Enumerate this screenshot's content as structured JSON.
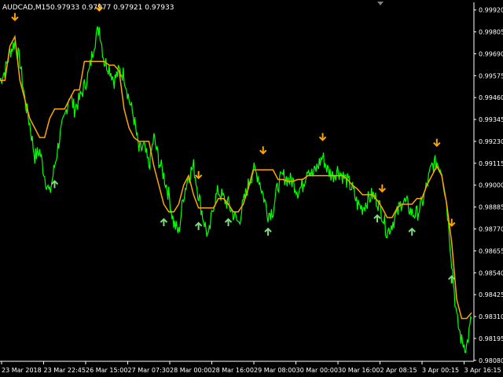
{
  "header": {
    "symbol_tf": "AUDCAD,M15",
    "ohlc": "0.97933 0.97977 0.97921 0.97933"
  },
  "colors": {
    "background": "#000000",
    "price": "#00ff00",
    "signal_line": "#ffa500",
    "arrow_down": "#ffa500",
    "arrow_up": "#7fd97f",
    "axis": "#ffffff"
  },
  "chart_data": {
    "type": "line",
    "ylim": [
      0.98075,
      0.9996
    ],
    "y_ticks": [
      "0.99920",
      "0.99805",
      "0.99690",
      "0.99575",
      "0.99460",
      "0.99345",
      "0.99230",
      "0.99115",
      "0.99000",
      "0.98885",
      "0.98770",
      "0.98655",
      "0.98540",
      "0.98425",
      "0.98310",
      "0.98195",
      "0.98080"
    ],
    "x_ticks": [
      "23 Mar 2018",
      "23 Mar 22:45",
      "26 Mar 15:00",
      "27 Mar 07:30",
      "28 Mar 00:00",
      "28 Mar 16:00",
      "29 Mar 08:00",
      "30 Mar 00:00",
      "30 Mar 16:00",
      "2 Apr 08:15",
      "3 Apr 00:15",
      "3 Apr 16:15"
    ],
    "series": [
      {
        "values": [
          0.9955,
          0.996,
          0.997,
          0.9975,
          0.9965,
          0.9945,
          0.9932,
          0.9915,
          0.9918,
          0.9905,
          0.9895,
          0.991,
          0.9925,
          0.9935,
          0.9948,
          0.994,
          0.9945,
          0.9952,
          0.996,
          0.9975,
          0.9983,
          0.9965,
          0.9962,
          0.9955,
          0.996,
          0.9958,
          0.9945,
          0.9935,
          0.9918,
          0.992,
          0.991,
          0.9925,
          0.9913,
          0.9905,
          0.9895,
          0.988,
          0.9875,
          0.9895,
          0.9905,
          0.991,
          0.9895,
          0.9882,
          0.9872,
          0.989,
          0.9897,
          0.9893,
          0.989,
          0.9885,
          0.988,
          0.989,
          0.99,
          0.9908,
          0.9905,
          0.9895,
          0.9885,
          0.9887,
          0.99,
          0.9905,
          0.9903,
          0.9902,
          0.9897,
          0.99,
          0.991,
          0.9905,
          0.991,
          0.9915,
          0.9908,
          0.9905,
          0.9908,
          0.9905,
          0.9902,
          0.9898,
          0.989,
          0.9888,
          0.9892,
          0.9895,
          0.9892,
          0.9885,
          0.9875,
          0.988,
          0.9885,
          0.9892,
          0.989,
          0.9885,
          0.9885,
          0.989,
          0.99,
          0.991,
          0.9912,
          0.9908,
          0.989,
          0.986,
          0.983,
          0.9818,
          0.9815,
          0.983
        ]
      },
      {
        "values": [
          0.9955,
          0.9955,
          0.9973,
          0.9978,
          0.9955,
          0.9945,
          0.9935,
          0.993,
          0.9925,
          0.9925,
          0.9935,
          0.994,
          0.994,
          0.994,
          0.9945,
          0.995,
          0.995,
          0.9965,
          0.9965,
          0.9965,
          0.9965,
          0.9965,
          0.9963,
          0.9963,
          0.996,
          0.994,
          0.993,
          0.9925,
          0.9923,
          0.9923,
          0.9923,
          0.991,
          0.99,
          0.989,
          0.9886,
          0.9886,
          0.989,
          0.99,
          0.9905,
          0.9895,
          0.9888,
          0.9888,
          0.9888,
          0.9888,
          0.9893,
          0.9893,
          0.989,
          0.9886,
          0.9886,
          0.989,
          0.9898,
          0.9908,
          0.9908,
          0.9908,
          0.9908,
          0.9908,
          0.9903,
          0.9903,
          0.9902,
          0.9902,
          0.9903,
          0.9903,
          0.9905,
          0.9905,
          0.9905,
          0.9905,
          0.9905,
          0.9905,
          0.9905,
          0.9905,
          0.9903,
          0.99,
          0.9898,
          0.9895,
          0.9895,
          0.9895,
          0.9892,
          0.9888,
          0.9883,
          0.9883,
          0.9888,
          0.989,
          0.989,
          0.989,
          0.9893,
          0.9893,
          0.99,
          0.9905,
          0.991,
          0.9905,
          0.989,
          0.987,
          0.984,
          0.983,
          0.983,
          0.9833
        ]
      }
    ],
    "markers_down": [
      3,
      20,
      40,
      53,
      65,
      77,
      88,
      91
    ],
    "markers_up": [
      11,
      33,
      40,
      46,
      54,
      76,
      83,
      91
    ]
  }
}
